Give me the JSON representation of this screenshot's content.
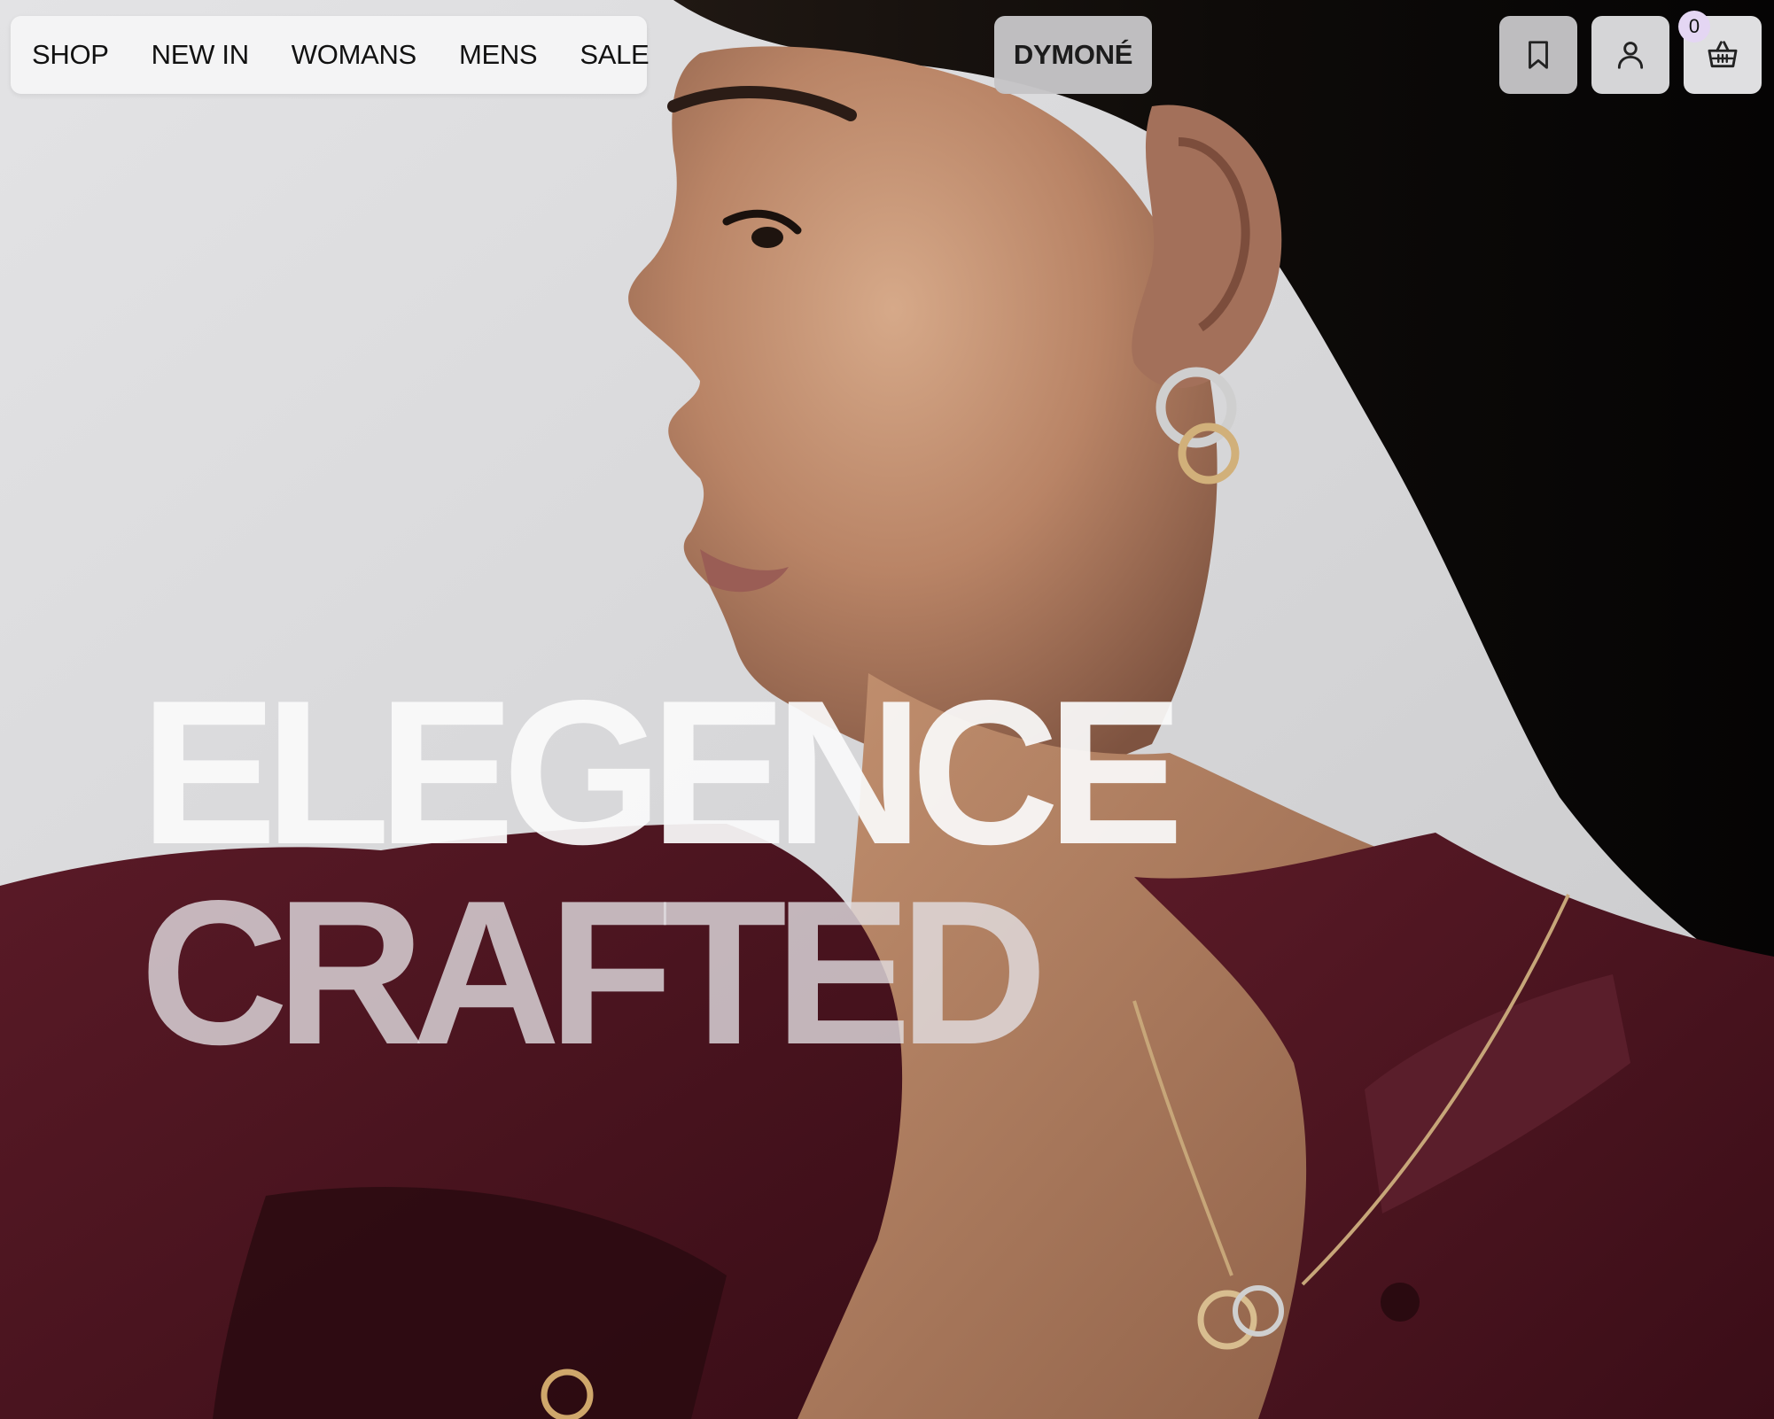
{
  "nav": {
    "items": [
      {
        "label": "SHOP"
      },
      {
        "label": "NEW IN"
      },
      {
        "label": "WOMANS"
      },
      {
        "label": "MENS"
      },
      {
        "label": "SALE"
      }
    ]
  },
  "brand": {
    "name": "DYMONÉ"
  },
  "actions": {
    "saved_icon": "bookmark-icon",
    "account_icon": "user-icon",
    "cart_icon": "basket-icon",
    "cart_count": "0"
  },
  "hero": {
    "headline_line1": "ELEGENCE",
    "headline_line2": "CRAFTED"
  },
  "colors": {
    "shirt": "#4a141f",
    "background": "#dcdcde",
    "hair": "#0c0a09",
    "badge": "#e4d6f3"
  }
}
